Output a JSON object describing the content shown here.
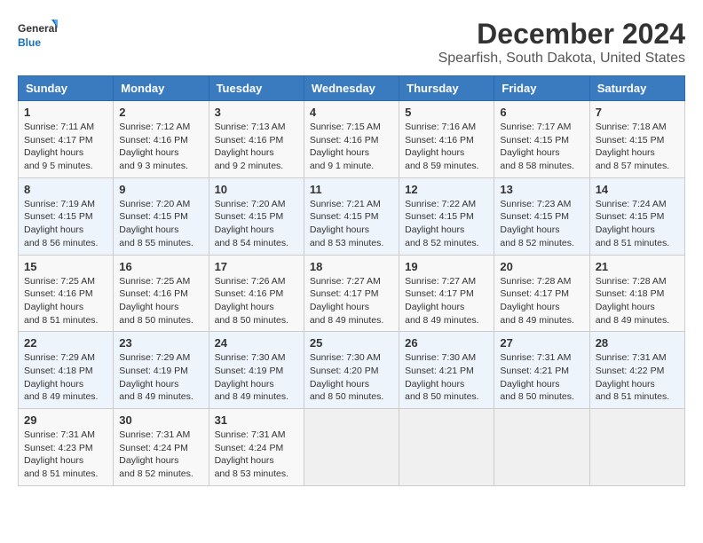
{
  "header": {
    "logo_line1": "General",
    "logo_line2": "Blue",
    "main_title": "December 2024",
    "subtitle": "Spearfish, South Dakota, United States"
  },
  "calendar": {
    "days_of_week": [
      "Sunday",
      "Monday",
      "Tuesday",
      "Wednesday",
      "Thursday",
      "Friday",
      "Saturday"
    ],
    "weeks": [
      [
        null,
        null,
        null,
        null,
        null,
        null,
        null
      ]
    ],
    "cells": [
      {
        "day": "1",
        "sunrise": "7:11 AM",
        "sunset": "4:17 PM",
        "daylight": "9 hours and 5 minutes."
      },
      {
        "day": "2",
        "sunrise": "7:12 AM",
        "sunset": "4:16 PM",
        "daylight": "9 hours and 3 minutes."
      },
      {
        "day": "3",
        "sunrise": "7:13 AM",
        "sunset": "4:16 PM",
        "daylight": "9 hours and 2 minutes."
      },
      {
        "day": "4",
        "sunrise": "7:15 AM",
        "sunset": "4:16 PM",
        "daylight": "9 hours and 1 minute."
      },
      {
        "day": "5",
        "sunrise": "7:16 AM",
        "sunset": "4:16 PM",
        "daylight": "8 hours and 59 minutes."
      },
      {
        "day": "6",
        "sunrise": "7:17 AM",
        "sunset": "4:15 PM",
        "daylight": "8 hours and 58 minutes."
      },
      {
        "day": "7",
        "sunrise": "7:18 AM",
        "sunset": "4:15 PM",
        "daylight": "8 hours and 57 minutes."
      },
      {
        "day": "8",
        "sunrise": "7:19 AM",
        "sunset": "4:15 PM",
        "daylight": "8 hours and 56 minutes."
      },
      {
        "day": "9",
        "sunrise": "7:20 AM",
        "sunset": "4:15 PM",
        "daylight": "8 hours and 55 minutes."
      },
      {
        "day": "10",
        "sunrise": "7:20 AM",
        "sunset": "4:15 PM",
        "daylight": "8 hours and 54 minutes."
      },
      {
        "day": "11",
        "sunrise": "7:21 AM",
        "sunset": "4:15 PM",
        "daylight": "8 hours and 53 minutes."
      },
      {
        "day": "12",
        "sunrise": "7:22 AM",
        "sunset": "4:15 PM",
        "daylight": "8 hours and 52 minutes."
      },
      {
        "day": "13",
        "sunrise": "7:23 AM",
        "sunset": "4:15 PM",
        "daylight": "8 hours and 52 minutes."
      },
      {
        "day": "14",
        "sunrise": "7:24 AM",
        "sunset": "4:15 PM",
        "daylight": "8 hours and 51 minutes."
      },
      {
        "day": "15",
        "sunrise": "7:25 AM",
        "sunset": "4:16 PM",
        "daylight": "8 hours and 51 minutes."
      },
      {
        "day": "16",
        "sunrise": "7:25 AM",
        "sunset": "4:16 PM",
        "daylight": "8 hours and 50 minutes."
      },
      {
        "day": "17",
        "sunrise": "7:26 AM",
        "sunset": "4:16 PM",
        "daylight": "8 hours and 50 minutes."
      },
      {
        "day": "18",
        "sunrise": "7:27 AM",
        "sunset": "4:17 PM",
        "daylight": "8 hours and 49 minutes."
      },
      {
        "day": "19",
        "sunrise": "7:27 AM",
        "sunset": "4:17 PM",
        "daylight": "8 hours and 49 minutes."
      },
      {
        "day": "20",
        "sunrise": "7:28 AM",
        "sunset": "4:17 PM",
        "daylight": "8 hours and 49 minutes."
      },
      {
        "day": "21",
        "sunrise": "7:28 AM",
        "sunset": "4:18 PM",
        "daylight": "8 hours and 49 minutes."
      },
      {
        "day": "22",
        "sunrise": "7:29 AM",
        "sunset": "4:18 PM",
        "daylight": "8 hours and 49 minutes."
      },
      {
        "day": "23",
        "sunrise": "7:29 AM",
        "sunset": "4:19 PM",
        "daylight": "8 hours and 49 minutes."
      },
      {
        "day": "24",
        "sunrise": "7:30 AM",
        "sunset": "4:19 PM",
        "daylight": "8 hours and 49 minutes."
      },
      {
        "day": "25",
        "sunrise": "7:30 AM",
        "sunset": "4:20 PM",
        "daylight": "8 hours and 50 minutes."
      },
      {
        "day": "26",
        "sunrise": "7:30 AM",
        "sunset": "4:21 PM",
        "daylight": "8 hours and 50 minutes."
      },
      {
        "day": "27",
        "sunrise": "7:31 AM",
        "sunset": "4:21 PM",
        "daylight": "8 hours and 50 minutes."
      },
      {
        "day": "28",
        "sunrise": "7:31 AM",
        "sunset": "4:22 PM",
        "daylight": "8 hours and 51 minutes."
      },
      {
        "day": "29",
        "sunrise": "7:31 AM",
        "sunset": "4:23 PM",
        "daylight": "8 hours and 51 minutes."
      },
      {
        "day": "30",
        "sunrise": "7:31 AM",
        "sunset": "4:24 PM",
        "daylight": "8 hours and 52 minutes."
      },
      {
        "day": "31",
        "sunrise": "7:31 AM",
        "sunset": "4:24 PM",
        "daylight": "8 hours and 53 minutes."
      }
    ]
  }
}
